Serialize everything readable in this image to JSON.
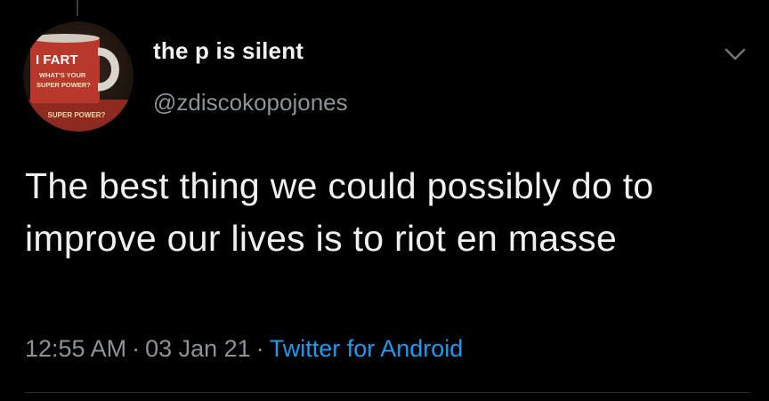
{
  "tweet": {
    "display_name": "the p is silent",
    "handle": "@zdiscokopojones",
    "text": "The best thing we could possibly do to improve our lives is to riot en masse",
    "time": "12:55 AM",
    "date": "03 Jan 21",
    "separator": "·",
    "source": "Twitter for Android"
  },
  "avatar": {
    "mug_text_line1": "I FART",
    "mug_text_line2": "WHAT'S YOUR",
    "mug_text_line3": "SUPER POWER?",
    "sign_text": "SUPER POWER?"
  },
  "icons": {
    "menu": "chevron-down-icon"
  },
  "colors": {
    "background": "#000000",
    "text": "#e7e9ea",
    "secondary": "#8b9298",
    "link": "#1d9bf0",
    "mug_red": "#b8382b"
  }
}
